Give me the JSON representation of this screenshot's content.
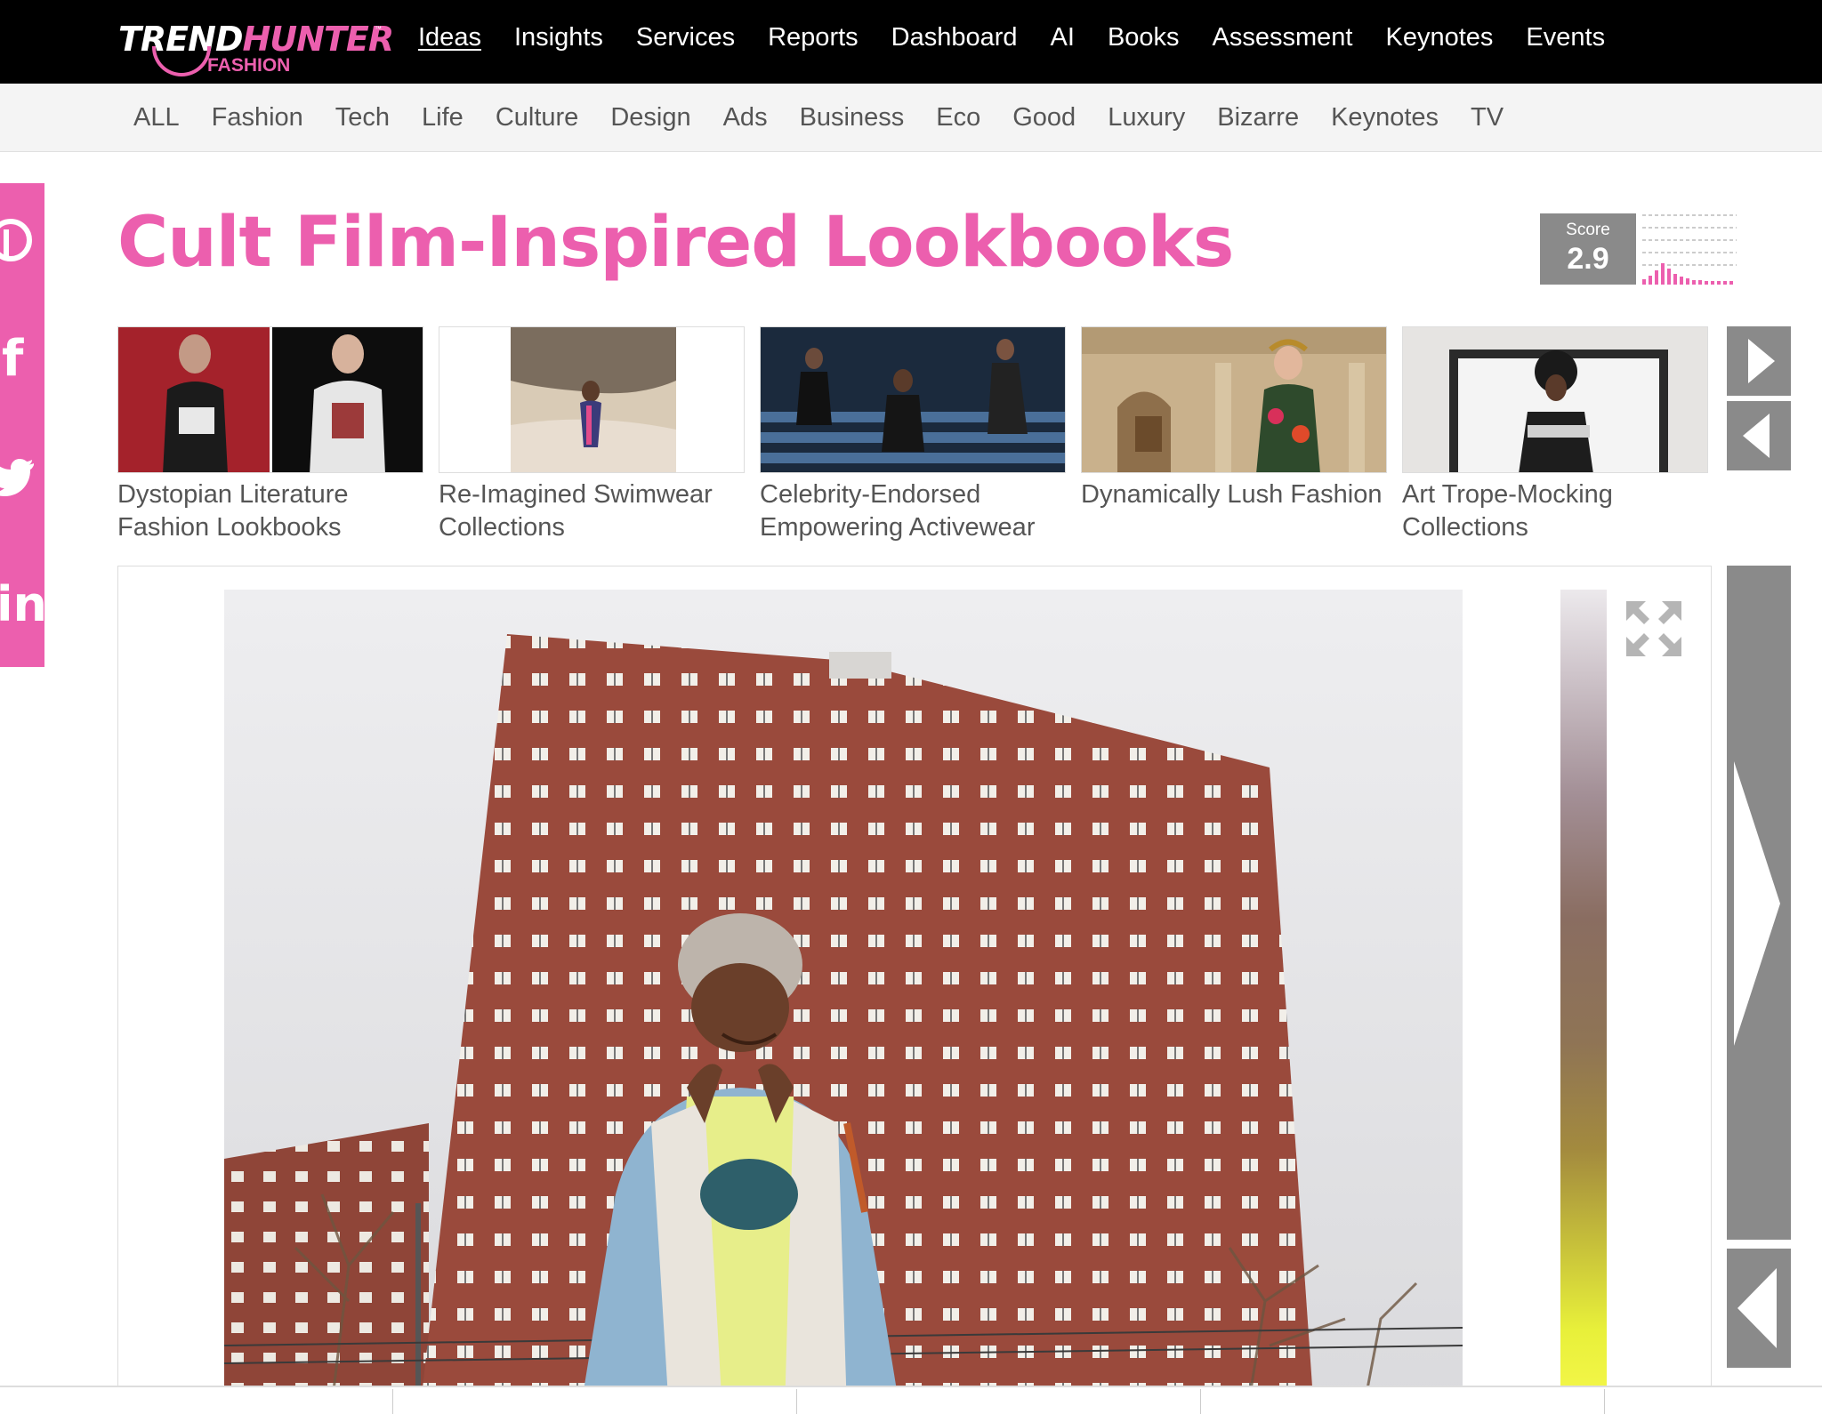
{
  "header": {
    "logo_main": "TRENDHUNTER",
    "logo_highlight": "HUNTER",
    "logo_prefix": "TREND",
    "logo_tm": "™",
    "logo_sub": "FASHION",
    "nav": [
      "Ideas",
      "Insights",
      "Services",
      "Reports",
      "Dashboard",
      "AI",
      "Books",
      "Assessment",
      "Keynotes",
      "Events"
    ],
    "active_nav": "Ideas"
  },
  "subnav": [
    "ALL",
    "Fashion",
    "Tech",
    "Life",
    "Culture",
    "Design",
    "Ads",
    "Business",
    "Eco",
    "Good",
    "Luxury",
    "Bizarre",
    "Keynotes",
    "TV"
  ],
  "social": [
    "pinterest-icon",
    "facebook-icon",
    "twitter-icon",
    "linkedin-icon"
  ],
  "article": {
    "title": "Cult Film-Inspired Lookbooks"
  },
  "score": {
    "label": "Score",
    "value": "2.9"
  },
  "related": [
    {
      "caption_line1": "Dystopian Literature",
      "caption_line2": "Fashion Lookbooks"
    },
    {
      "caption_line1": "Re-Imagined Swimwear",
      "caption_line2": "Collections"
    },
    {
      "caption_line1": "Celebrity-Endorsed",
      "caption_line2": "Empowering Activewear"
    },
    {
      "caption_line1": "Dynamically Lush Fashion",
      "caption_line2": ""
    },
    {
      "caption_line1": "Art Trope-Mocking",
      "caption_line2": "Collections"
    }
  ],
  "colors": {
    "brand_pink": "#ec5fae",
    "nav_bg": "#000000",
    "subnav_bg": "#f4f4f4",
    "control_gray": "#8a8a8a"
  }
}
